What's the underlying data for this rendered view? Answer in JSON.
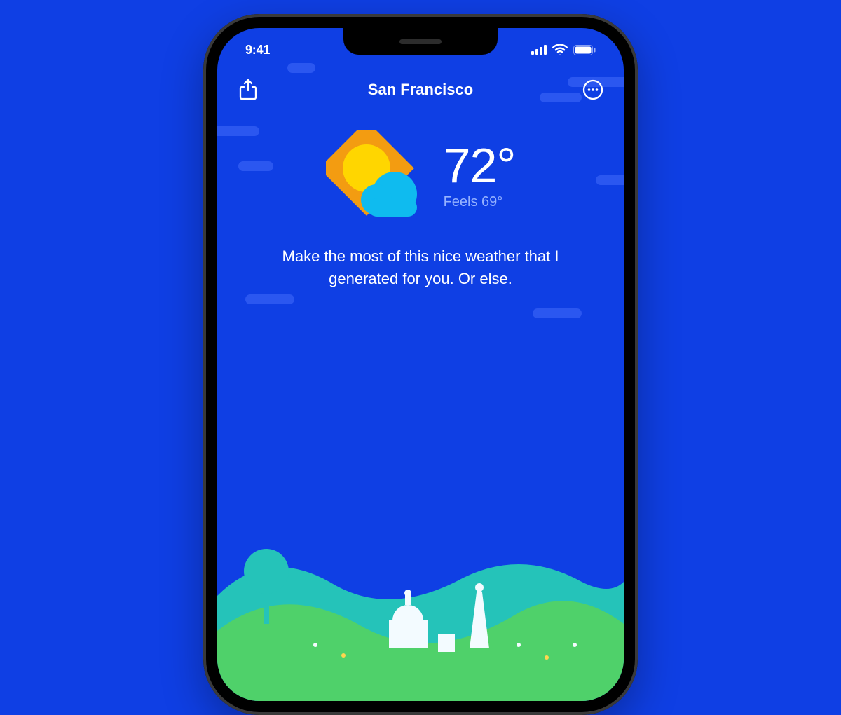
{
  "status_bar": {
    "time": "9:41"
  },
  "header": {
    "location": "San Francisco"
  },
  "weather": {
    "temperature": "72°",
    "feels_like": "Feels 69°",
    "summary": "Make the most of this nice weather that I generated for you. Or else."
  },
  "colors": {
    "background": "#0F3FE4",
    "cloud": "#2B57F0",
    "sun_fill": "#FFD600",
    "sun_rays": "#F39C11",
    "cloud_icon": "#0FBBEF",
    "feels_text": "#95B2FF"
  }
}
